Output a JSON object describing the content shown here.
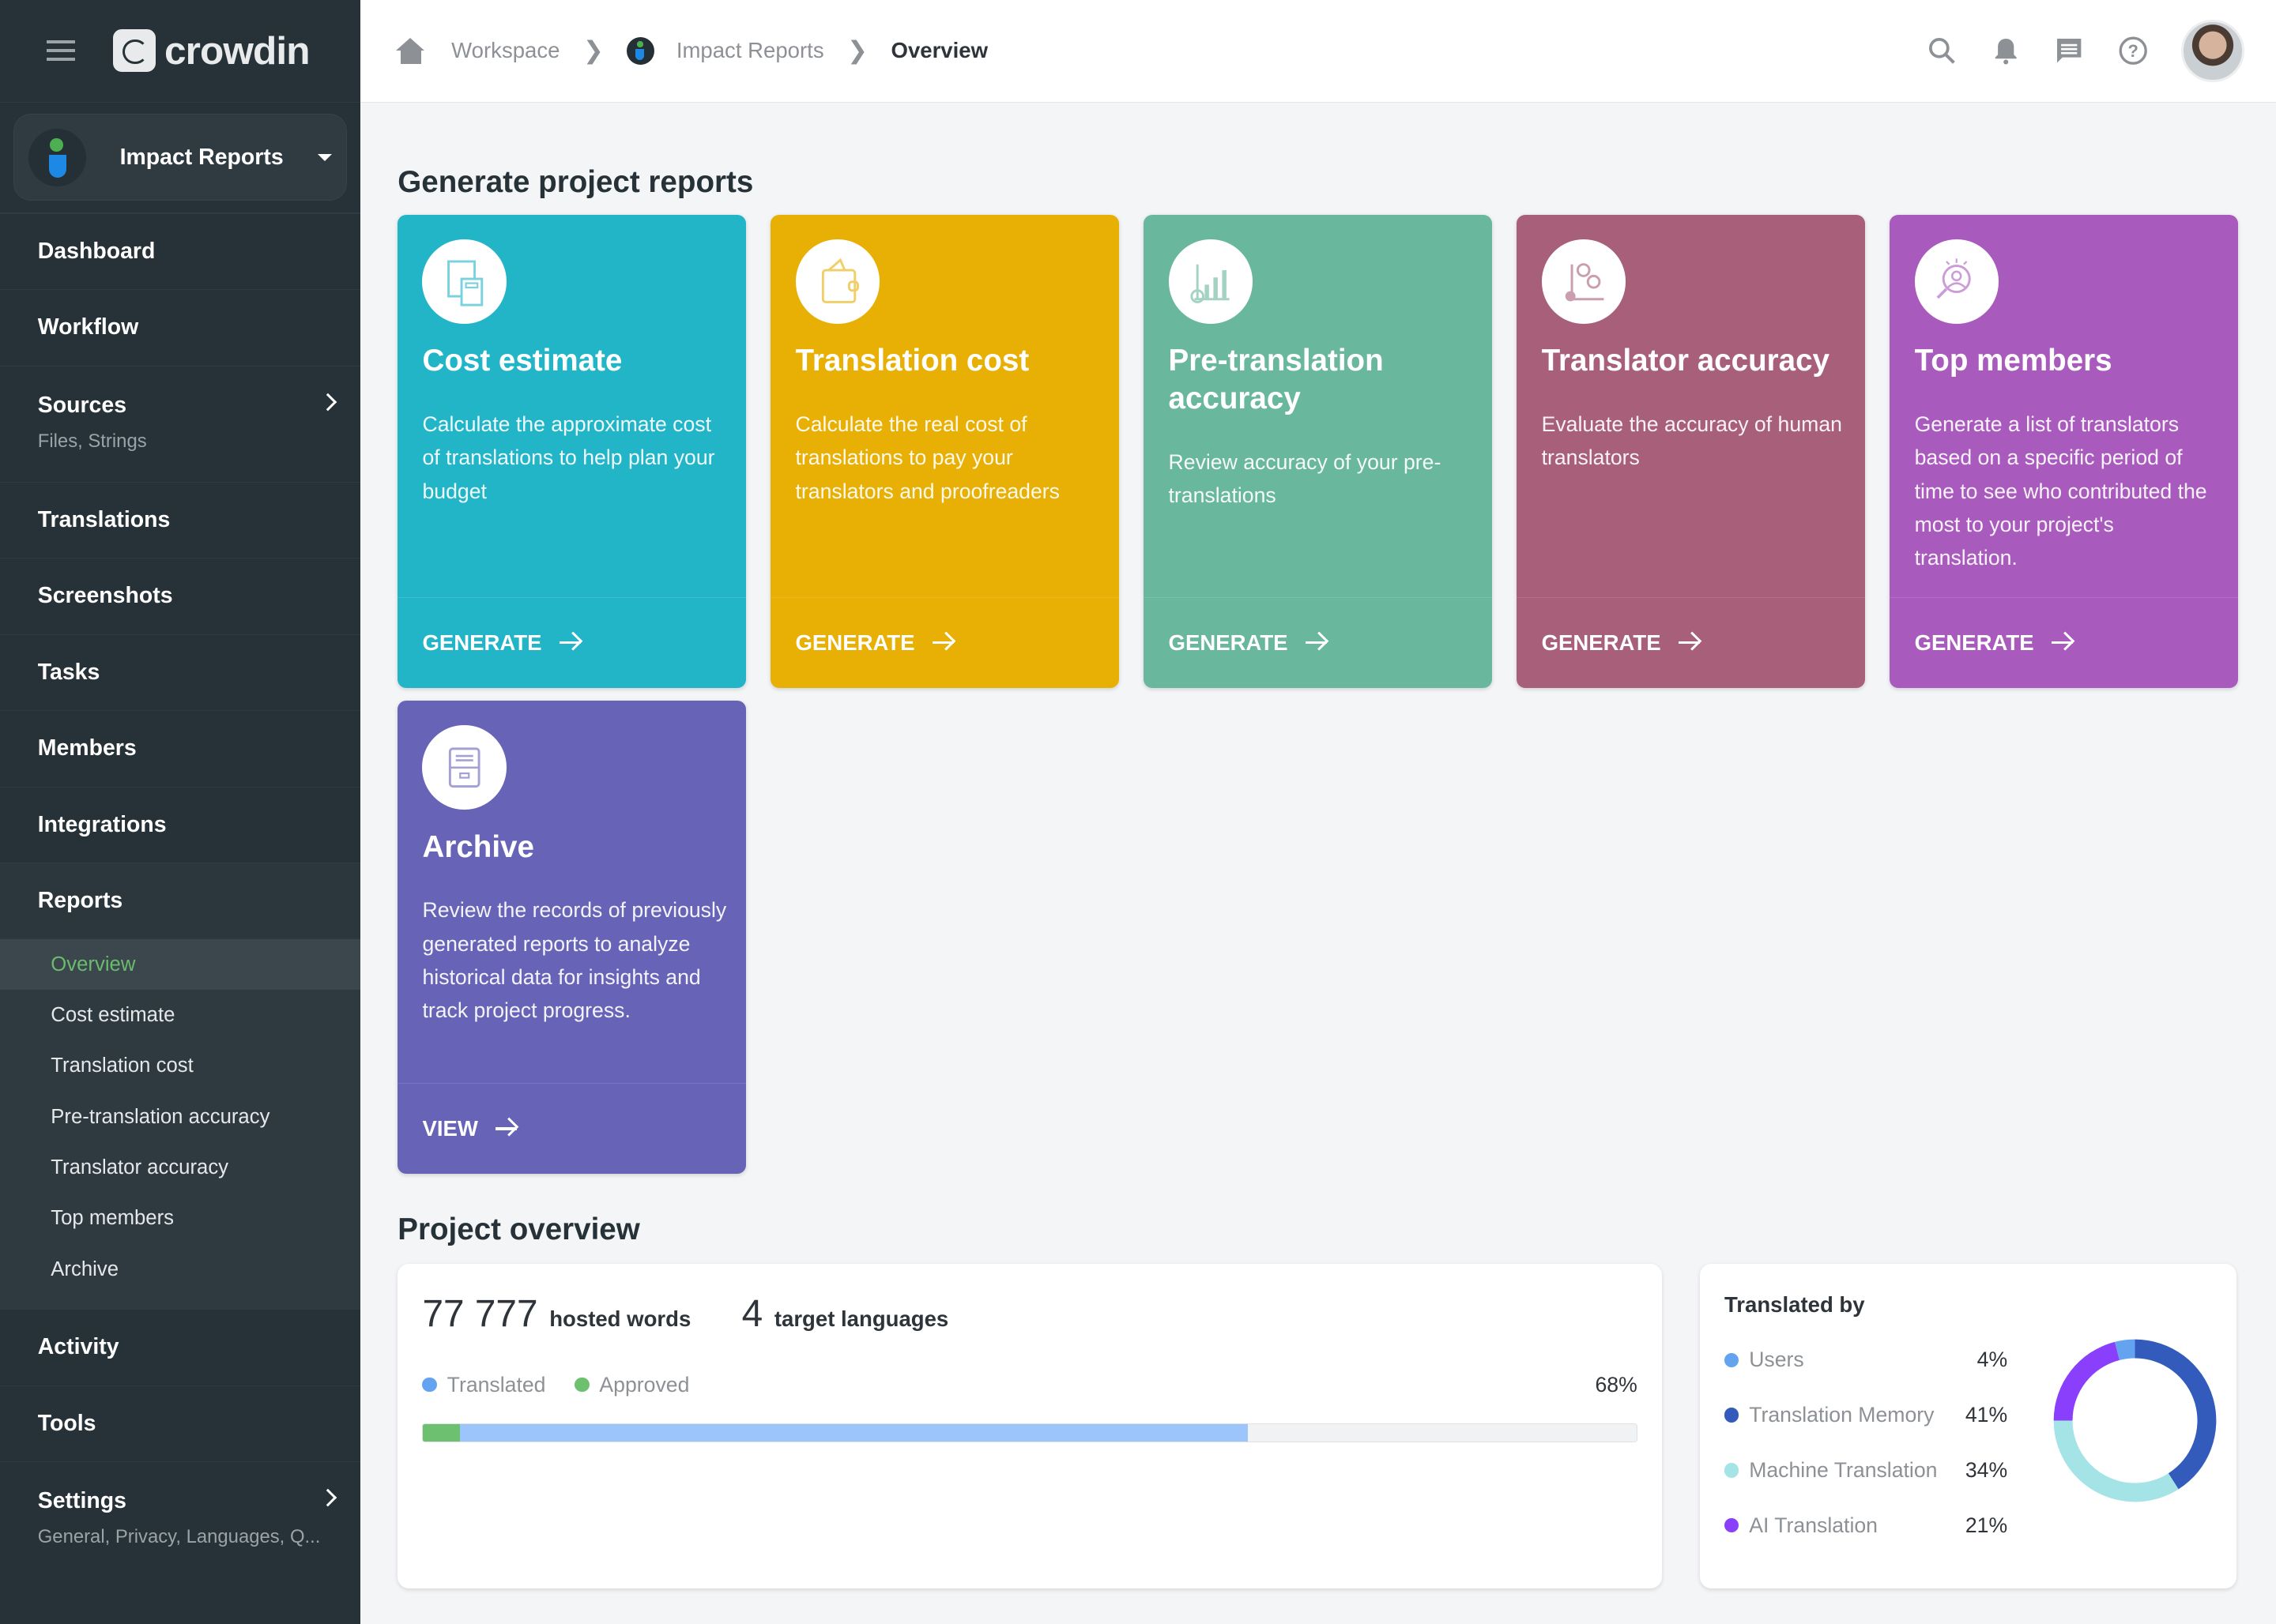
{
  "app": {
    "logo_text": "crowdin"
  },
  "project_switcher": {
    "name": "Impact Reports"
  },
  "breadcrumb": {
    "items": [
      "Workspace",
      "Impact Reports",
      "Overview"
    ]
  },
  "sidebar": {
    "items": [
      {
        "label": "Dashboard"
      },
      {
        "label": "Workflow"
      },
      {
        "label": "Sources",
        "sub": "Files, Strings"
      },
      {
        "label": "Translations"
      },
      {
        "label": "Screenshots"
      },
      {
        "label": "Tasks"
      },
      {
        "label": "Members"
      },
      {
        "label": "Integrations"
      },
      {
        "label": "Reports"
      },
      {
        "label": "Activity"
      },
      {
        "label": "Tools"
      },
      {
        "label": "Settings",
        "sub": "General, Privacy, Languages, Q..."
      }
    ],
    "reports_sub": [
      "Overview",
      "Cost estimate",
      "Translation cost",
      "Pre-translation accuracy",
      "Translator accuracy",
      "Top members",
      "Archive"
    ]
  },
  "main": {
    "generate_heading": "Generate project reports",
    "cards": [
      {
        "title": "Cost estimate",
        "desc": "Calculate the approximate cost of translations to help plan your budget",
        "action": "GENERATE",
        "color": "#22b5c7",
        "icon": "invoice-calculator-icon"
      },
      {
        "title": "Translation cost",
        "desc": "Calculate the real cost of translations to pay your translators and proofreaders",
        "action": "GENERATE",
        "color": "#e8b005",
        "icon": "wallet-icon"
      },
      {
        "title": "Pre-translation accuracy",
        "desc": "Review accuracy of your pre-translations",
        "action": "GENERATE",
        "color": "#69b79c",
        "icon": "chart-growth-icon"
      },
      {
        "title": "Translator accuracy",
        "desc": "Evaluate the accuracy of human translators",
        "action": "GENERATE",
        "color": "#a85f7a",
        "icon": "people-chart-icon"
      },
      {
        "title": "Top members",
        "desc": "Generate a list of translators based on a specific period of time to see who contributed the most to your project's translation.",
        "action": "GENERATE",
        "color": "#a95bbd",
        "icon": "user-search-icon"
      },
      {
        "title": "Archive",
        "desc": "Review the records of previously generated reports to analyze historical data for insights and track project progress.",
        "action": "VIEW",
        "color": "#6764b8",
        "icon": "archive-icon"
      }
    ],
    "overview_heading": "Project overview",
    "overview": {
      "hosted_words": "77 777",
      "hosted_words_label": "hosted words",
      "target_languages": "4",
      "target_languages_label": "target languages",
      "legend": [
        "Translated",
        "Approved"
      ],
      "translated_pct_label": "68%",
      "translated_fraction": 0.68,
      "approved_fraction": 0.03,
      "colors": {
        "translated": "#9bc5fb",
        "approved": "#6cc070"
      }
    },
    "translated_by": {
      "title": "Translated by",
      "items": [
        {
          "label": "Users",
          "pct": "4%",
          "value": 4,
          "color": "#64a3ef"
        },
        {
          "label": "Translation Memory",
          "pct": "41%",
          "value": 41,
          "color": "#335bbb"
        },
        {
          "label": "Machine Translation",
          "pct": "34%",
          "value": 34,
          "color": "#a5e4e6"
        },
        {
          "label": "AI Translation",
          "pct": "21%",
          "value": 21,
          "color": "#8a3ffc"
        }
      ]
    }
  }
}
